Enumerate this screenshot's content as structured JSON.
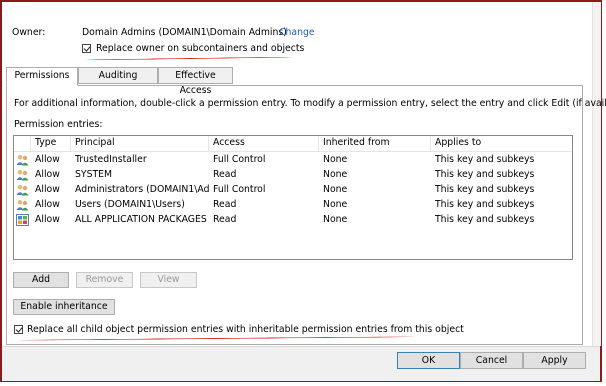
{
  "owner": {
    "label": "Owner:",
    "value": "Domain Admins (DOMAIN1\\Domain Admins)",
    "change_link": "Change",
    "replace_checkbox_label": "Replace owner on subcontainers and objects",
    "replace_checked": true
  },
  "tabs": [
    {
      "label": "Permissions",
      "active": true
    },
    {
      "label": "Auditing",
      "active": false
    },
    {
      "label": "Effective Access",
      "active": false
    }
  ],
  "permissions": {
    "info_text": "For additional information, double-click a permission entry. To modify a permission entry, select the entry and click Edit (if available).",
    "entries_label": "Permission entries:",
    "columns": [
      "Type",
      "Principal",
      "Access",
      "Inherited from",
      "Applies to"
    ],
    "rows": [
      {
        "icon": "users-icon",
        "type": "Allow",
        "principal": "TrustedInstaller",
        "access": "Full Control",
        "inherited": "None",
        "applies": "This key and subkeys"
      },
      {
        "icon": "users-icon",
        "type": "Allow",
        "principal": "SYSTEM",
        "access": "Read",
        "inherited": "None",
        "applies": "This key and subkeys"
      },
      {
        "icon": "users-icon",
        "type": "Allow",
        "principal": "Administrators (DOMAIN1\\Ad...",
        "access": "Full Control",
        "inherited": "None",
        "applies": "This key and subkeys"
      },
      {
        "icon": "users-icon",
        "type": "Allow",
        "principal": "Users (DOMAIN1\\Users)",
        "access": "Read",
        "inherited": "None",
        "applies": "This key and subkeys"
      },
      {
        "icon": "packages-icon",
        "type": "Allow",
        "principal": "ALL APPLICATION PACKAGES",
        "access": "Read",
        "inherited": "None",
        "applies": "This key and subkeys"
      }
    ],
    "buttons": {
      "add": "Add",
      "remove": "Remove",
      "view": "View"
    },
    "enable_inheritance": "Enable inheritance",
    "replace_all_label": "Replace all child object permission entries with inheritable permission entries from this object",
    "replace_all_checked": true
  },
  "footer": {
    "ok": "OK",
    "cancel": "Cancel",
    "apply": "Apply"
  },
  "colors": {
    "annotation_red": "#d41c1c",
    "link_blue": "#1e5fb4",
    "frame": "#8b1a1a"
  }
}
